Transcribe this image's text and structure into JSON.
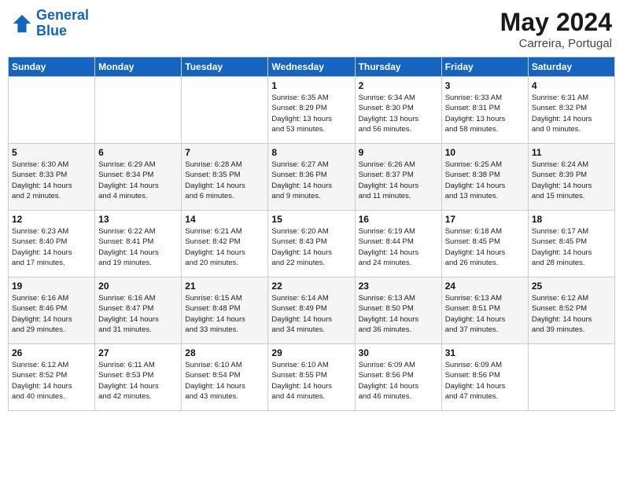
{
  "header": {
    "logo_line1": "General",
    "logo_line2": "Blue",
    "month_title": "May 2024",
    "location": "Carreira, Portugal"
  },
  "weekdays": [
    "Sunday",
    "Monday",
    "Tuesday",
    "Wednesday",
    "Thursday",
    "Friday",
    "Saturday"
  ],
  "weeks": [
    [
      {
        "day": "",
        "info": ""
      },
      {
        "day": "",
        "info": ""
      },
      {
        "day": "",
        "info": ""
      },
      {
        "day": "1",
        "info": "Sunrise: 6:35 AM\nSunset: 8:29 PM\nDaylight: 13 hours\nand 53 minutes."
      },
      {
        "day": "2",
        "info": "Sunrise: 6:34 AM\nSunset: 8:30 PM\nDaylight: 13 hours\nand 56 minutes."
      },
      {
        "day": "3",
        "info": "Sunrise: 6:33 AM\nSunset: 8:31 PM\nDaylight: 13 hours\nand 58 minutes."
      },
      {
        "day": "4",
        "info": "Sunrise: 6:31 AM\nSunset: 8:32 PM\nDaylight: 14 hours\nand 0 minutes."
      }
    ],
    [
      {
        "day": "5",
        "info": "Sunrise: 6:30 AM\nSunset: 8:33 PM\nDaylight: 14 hours\nand 2 minutes."
      },
      {
        "day": "6",
        "info": "Sunrise: 6:29 AM\nSunset: 8:34 PM\nDaylight: 14 hours\nand 4 minutes."
      },
      {
        "day": "7",
        "info": "Sunrise: 6:28 AM\nSunset: 8:35 PM\nDaylight: 14 hours\nand 6 minutes."
      },
      {
        "day": "8",
        "info": "Sunrise: 6:27 AM\nSunset: 8:36 PM\nDaylight: 14 hours\nand 9 minutes."
      },
      {
        "day": "9",
        "info": "Sunrise: 6:26 AM\nSunset: 8:37 PM\nDaylight: 14 hours\nand 11 minutes."
      },
      {
        "day": "10",
        "info": "Sunrise: 6:25 AM\nSunset: 8:38 PM\nDaylight: 14 hours\nand 13 minutes."
      },
      {
        "day": "11",
        "info": "Sunrise: 6:24 AM\nSunset: 8:39 PM\nDaylight: 14 hours\nand 15 minutes."
      }
    ],
    [
      {
        "day": "12",
        "info": "Sunrise: 6:23 AM\nSunset: 8:40 PM\nDaylight: 14 hours\nand 17 minutes."
      },
      {
        "day": "13",
        "info": "Sunrise: 6:22 AM\nSunset: 8:41 PM\nDaylight: 14 hours\nand 19 minutes."
      },
      {
        "day": "14",
        "info": "Sunrise: 6:21 AM\nSunset: 8:42 PM\nDaylight: 14 hours\nand 20 minutes."
      },
      {
        "day": "15",
        "info": "Sunrise: 6:20 AM\nSunset: 8:43 PM\nDaylight: 14 hours\nand 22 minutes."
      },
      {
        "day": "16",
        "info": "Sunrise: 6:19 AM\nSunset: 8:44 PM\nDaylight: 14 hours\nand 24 minutes."
      },
      {
        "day": "17",
        "info": "Sunrise: 6:18 AM\nSunset: 8:45 PM\nDaylight: 14 hours\nand 26 minutes."
      },
      {
        "day": "18",
        "info": "Sunrise: 6:17 AM\nSunset: 8:45 PM\nDaylight: 14 hours\nand 28 minutes."
      }
    ],
    [
      {
        "day": "19",
        "info": "Sunrise: 6:16 AM\nSunset: 8:46 PM\nDaylight: 14 hours\nand 29 minutes."
      },
      {
        "day": "20",
        "info": "Sunrise: 6:16 AM\nSunset: 8:47 PM\nDaylight: 14 hours\nand 31 minutes."
      },
      {
        "day": "21",
        "info": "Sunrise: 6:15 AM\nSunset: 8:48 PM\nDaylight: 14 hours\nand 33 minutes."
      },
      {
        "day": "22",
        "info": "Sunrise: 6:14 AM\nSunset: 8:49 PM\nDaylight: 14 hours\nand 34 minutes."
      },
      {
        "day": "23",
        "info": "Sunrise: 6:13 AM\nSunset: 8:50 PM\nDaylight: 14 hours\nand 36 minutes."
      },
      {
        "day": "24",
        "info": "Sunrise: 6:13 AM\nSunset: 8:51 PM\nDaylight: 14 hours\nand 37 minutes."
      },
      {
        "day": "25",
        "info": "Sunrise: 6:12 AM\nSunset: 8:52 PM\nDaylight: 14 hours\nand 39 minutes."
      }
    ],
    [
      {
        "day": "26",
        "info": "Sunrise: 6:12 AM\nSunset: 8:52 PM\nDaylight: 14 hours\nand 40 minutes."
      },
      {
        "day": "27",
        "info": "Sunrise: 6:11 AM\nSunset: 8:53 PM\nDaylight: 14 hours\nand 42 minutes."
      },
      {
        "day": "28",
        "info": "Sunrise: 6:10 AM\nSunset: 8:54 PM\nDaylight: 14 hours\nand 43 minutes."
      },
      {
        "day": "29",
        "info": "Sunrise: 6:10 AM\nSunset: 8:55 PM\nDaylight: 14 hours\nand 44 minutes."
      },
      {
        "day": "30",
        "info": "Sunrise: 6:09 AM\nSunset: 8:56 PM\nDaylight: 14 hours\nand 46 minutes."
      },
      {
        "day": "31",
        "info": "Sunrise: 6:09 AM\nSunset: 8:56 PM\nDaylight: 14 hours\nand 47 minutes."
      },
      {
        "day": "",
        "info": ""
      }
    ]
  ]
}
